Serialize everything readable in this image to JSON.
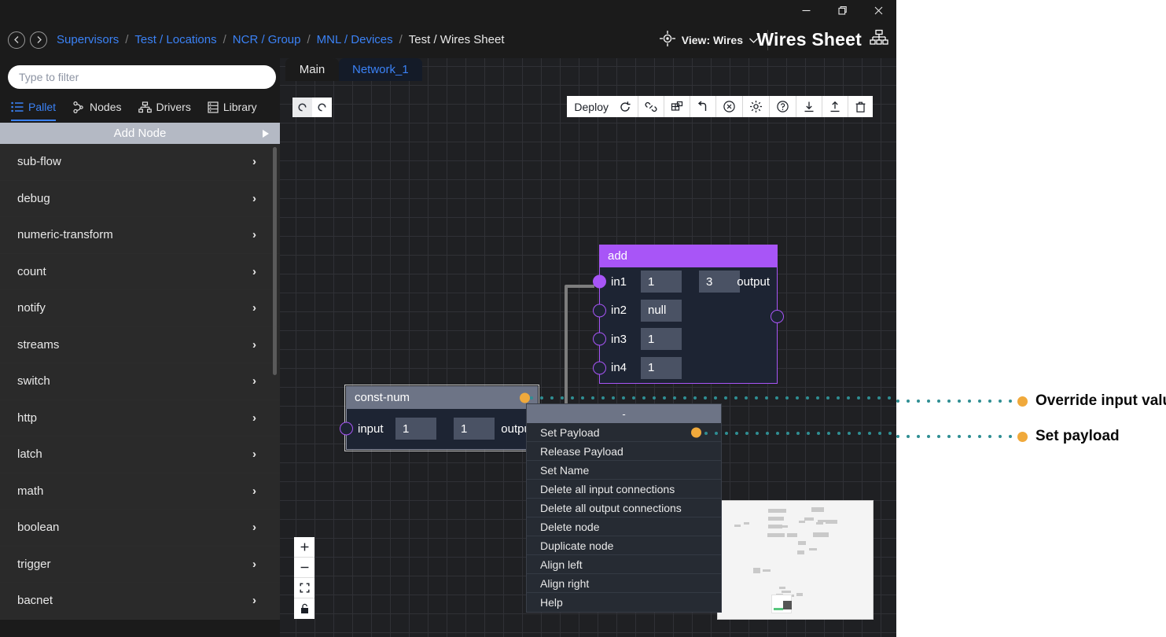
{
  "window": {
    "controls": [
      {
        "name": "minimize",
        "glyph": "minimize-icon"
      },
      {
        "name": "maximize",
        "glyph": "maximize-icon"
      },
      {
        "name": "close",
        "glyph": "close-icon"
      }
    ]
  },
  "breadcrumb": {
    "back_icon": "chevron-left-icon",
    "forward_icon": "chevron-right-icon",
    "separator": "/",
    "items": [
      {
        "label": "Supervisors",
        "active": false
      },
      {
        "label": "Test / Locations",
        "active": false
      },
      {
        "label": "NCR / Group",
        "active": false
      },
      {
        "label": "MNL / Devices",
        "active": false
      },
      {
        "label": "Test / Wires Sheet",
        "active": true
      }
    ]
  },
  "header": {
    "view_icon": "target-icon",
    "view_label": "View: Wires",
    "view_chevron": "chevron-down-icon",
    "sheet_title": "Wires Sheet",
    "sheet_icon": "sitemap-icon"
  },
  "sidebar": {
    "filter": {
      "value": "",
      "placeholder": "Type to filter"
    },
    "tabs": [
      {
        "label": "Pallet",
        "icon": "list-icon",
        "active": true
      },
      {
        "label": "Nodes",
        "icon": "nodes-icon",
        "active": false
      },
      {
        "label": "Drivers",
        "icon": "drivers-icon",
        "active": false
      },
      {
        "label": "Library",
        "icon": "library-icon",
        "active": false
      }
    ],
    "add_node": {
      "label": "Add Node",
      "arrow_icon": "triangle-right-icon"
    },
    "items": [
      {
        "label": "sub-flow",
        "chevron": "›"
      },
      {
        "label": "debug",
        "chevron": "›"
      },
      {
        "label": "numeric-transform",
        "chevron": "›"
      },
      {
        "label": "count",
        "chevron": "›"
      },
      {
        "label": "notify",
        "chevron": "›"
      },
      {
        "label": "streams",
        "chevron": "›"
      },
      {
        "label": "switch",
        "chevron": "›"
      },
      {
        "label": "http",
        "chevron": "›"
      },
      {
        "label": "latch",
        "chevron": "›"
      },
      {
        "label": "math",
        "chevron": "›"
      },
      {
        "label": "boolean",
        "chevron": "›"
      },
      {
        "label": "trigger",
        "chevron": "›"
      },
      {
        "label": "bacnet",
        "chevron": "›"
      }
    ]
  },
  "canvas": {
    "tabs": [
      {
        "label": "Main",
        "active": true
      },
      {
        "label": "Network_1",
        "active": false
      }
    ],
    "undo_redo": [
      {
        "name": "undo-icon"
      },
      {
        "name": "redo-icon"
      }
    ],
    "toolbar": {
      "deploy_label": "Deploy",
      "buttons": [
        {
          "name": "deploy-refresh-icon"
        },
        {
          "name": "link-icon"
        },
        {
          "name": "layout-icon"
        },
        {
          "name": "undo-arrow-icon"
        },
        {
          "name": "cancel-icon"
        },
        {
          "name": "settings-icon"
        },
        {
          "name": "help-icon"
        },
        {
          "name": "download-icon"
        },
        {
          "name": "upload-icon"
        },
        {
          "name": "trash-icon"
        }
      ]
    },
    "zoom_controls": [
      {
        "name": "zoom-in-icon",
        "glyph": "+"
      },
      {
        "name": "zoom-out-icon",
        "glyph": "−"
      },
      {
        "name": "fit-view-icon",
        "glyph": "⛶"
      },
      {
        "name": "lock-icon",
        "glyph": "🔓"
      }
    ]
  },
  "nodes": [
    {
      "id": "add",
      "title": "add",
      "accent": "#a855f7",
      "inputs": [
        {
          "label": "in1",
          "value": "1",
          "connected": true
        },
        {
          "label": "in2",
          "value": "null",
          "connected": false
        },
        {
          "label": "in3",
          "value": "1",
          "connected": false
        },
        {
          "label": "in4",
          "value": "1",
          "connected": false
        }
      ],
      "output": {
        "label": "output",
        "value": "3"
      }
    },
    {
      "id": "const-num",
      "title": "const-num",
      "accent": "#6d7486",
      "inputs": [
        {
          "label": "input",
          "value": "1",
          "connected": false
        }
      ],
      "output": {
        "label": "output",
        "value": "1"
      },
      "has_payload_dot": true
    }
  ],
  "context_menu": {
    "header": "-",
    "items": [
      {
        "label": "Set Payload",
        "has_dot": true
      },
      {
        "label": "Release Payload",
        "has_dot": false
      },
      {
        "label": "Set Name",
        "has_dot": false
      },
      {
        "label": "Delete all input connections",
        "has_dot": false
      },
      {
        "label": "Delete all output connections",
        "has_dot": false
      },
      {
        "label": "Delete node",
        "has_dot": false
      },
      {
        "label": "Duplicate node",
        "has_dot": false
      },
      {
        "label": "Align left",
        "has_dot": false
      },
      {
        "label": "Align right",
        "has_dot": false
      },
      {
        "label": "Help",
        "has_dot": false
      }
    ]
  },
  "annotations": [
    {
      "label": "Override input value",
      "dot_color": "#f0a93b",
      "line_color": "#2f8e93"
    },
    {
      "label": "Set payload",
      "dot_color": "#f0a93b",
      "line_color": "#2f8e93"
    }
  ],
  "colors": {
    "accent_blue": "#3b82f6",
    "node_purple": "#a855f7",
    "payload_orange": "#f0a93b",
    "leader_teal": "#2f8e93",
    "canvas_bg": "#1f2023",
    "app_bg": "#1b1b1b"
  }
}
